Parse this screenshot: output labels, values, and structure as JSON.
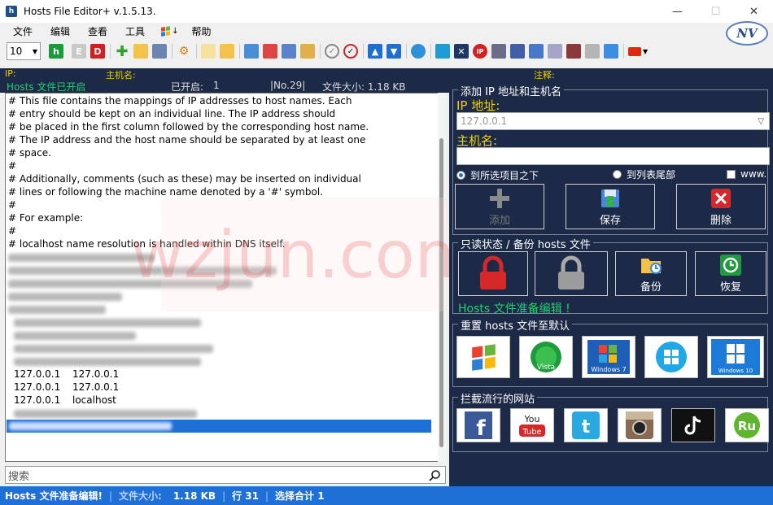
{
  "window": {
    "title": "Hosts File Editor+ v.1.5.13.",
    "app_icon_letter": "h",
    "minimize": "—",
    "maximize": "☐",
    "close": "✕"
  },
  "menu": {
    "items": [
      "文件",
      "编辑",
      "查看",
      "工具",
      "帮助"
    ],
    "flag_arrow": "↓"
  },
  "logo": {
    "text": "NV"
  },
  "toolbar": {
    "font_size_value": "10",
    "btn_h": "h",
    "btn_e": "E",
    "btn_d": "D",
    "ip_btn": "IP"
  },
  "info": {
    "ip_label": "IP:",
    "hostname_label": "主机名:",
    "comment_label": "注释:"
  },
  "status_top": {
    "hosts_state": "Hosts 文件已开启",
    "opened_label": "已开启:",
    "opened_value": "1",
    "number": "|No.29|",
    "filesize": "文件大小: 1.18 KB"
  },
  "editor": {
    "lines": [
      "# This file contains the mappings of IP addresses to host names. Each",
      "# entry should be kept on an individual line. The IP address should",
      "# be placed in the first column followed by the corresponding host name.",
      "# The IP address and the host name should be separated by at least one",
      "# space.",
      "#",
      "# Additionally, comments (such as these) may be inserted on individual",
      "# lines or following the machine name denoted by a '#' symbol.",
      "#",
      "# For example:",
      "#",
      "# localhost name resolution is handled within DNS itself."
    ],
    "entries": [
      {
        "ip": "127.0.0.1",
        "host": "127.0.0.1"
      },
      {
        "ip": "127.0.0.1",
        "host": "127.0.0.1"
      },
      {
        "ip": "127.0.0.1",
        "host": "localhost"
      }
    ],
    "watermark": "wzjun.com"
  },
  "search": {
    "placeholder": "搜索"
  },
  "add_group": {
    "title": "添加 IP 地址和主机名",
    "ip_label": "IP 地址:",
    "ip_placeholder": "127.0.0.1",
    "host_label": "主机名:",
    "radio_before": "到所选项目之下",
    "radio_end": "到列表尾部",
    "www": "www.",
    "btn_add": "添加",
    "btn_save": "保存",
    "btn_delete": "删除"
  },
  "backup_group": {
    "title": "只读状态 / 备份 hosts 文件",
    "btn_backup": "备份",
    "btn_restore": "恢复",
    "ready": "Hosts 文件准备编辑 !"
  },
  "reset_group": {
    "title": "重置 hosts 文件至默认",
    "os": [
      "Windows XP",
      "Vista",
      "Windows 7",
      "Windows 8",
      "Windows 10"
    ]
  },
  "block_group": {
    "title": "拦截流行的网站",
    "sites": [
      "f",
      "You Tube",
      "Twitter",
      "Instagram",
      "TikTok",
      "Ru"
    ]
  },
  "bottom": {
    "ready": "Hosts 文件准备编辑!",
    "size_label": "文件大小:",
    "size_value": "1.18 KB",
    "line": "行 31",
    "selection": "选择合计 1"
  },
  "colors": {
    "panel_bg": "#1c2a48",
    "accent_yellow": "#f2d100",
    "accent_green": "#21d16d",
    "status_blue": "#1e6fd6"
  }
}
